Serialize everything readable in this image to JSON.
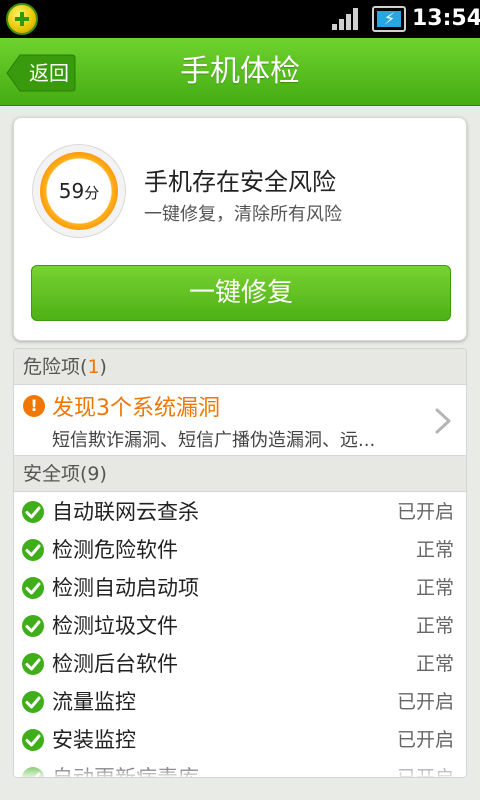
{
  "status_bar": {
    "time": "13:54",
    "icons": [
      "app-logo-icon",
      "signal-icon",
      "battery-charging-icon"
    ]
  },
  "header": {
    "back_label": "返回",
    "title": "手机体检"
  },
  "score_card": {
    "score": "59",
    "score_unit": "分",
    "headline": "手机存在安全风险",
    "subline": "一键修复，清除所有风险",
    "fix_button": "一键修复"
  },
  "danger_section": {
    "label": "危险项",
    "count_open": "(",
    "count": "1",
    "count_close": ")",
    "item": {
      "title": "发现3个系统漏洞",
      "detail": "短信欺诈漏洞、短信广播伪造漏洞、远..."
    }
  },
  "safe_section": {
    "label": "安全项(9)",
    "items": [
      {
        "label": "自动联网云查杀",
        "status": "已开启"
      },
      {
        "label": "检测危险软件",
        "status": "正常"
      },
      {
        "label": "检测自动启动项",
        "status": "正常"
      },
      {
        "label": "检测垃圾文件",
        "status": "正常"
      },
      {
        "label": "检测后台软件",
        "status": "正常"
      },
      {
        "label": "流量监控",
        "status": "已开启"
      },
      {
        "label": "安装监控",
        "status": "已开启"
      },
      {
        "label": "自动更新病毒库",
        "status": "已开启"
      }
    ]
  },
  "colors": {
    "brand_green": "#4eb116",
    "warning_orange": "#f07800",
    "ok_green": "#3fae1a"
  }
}
